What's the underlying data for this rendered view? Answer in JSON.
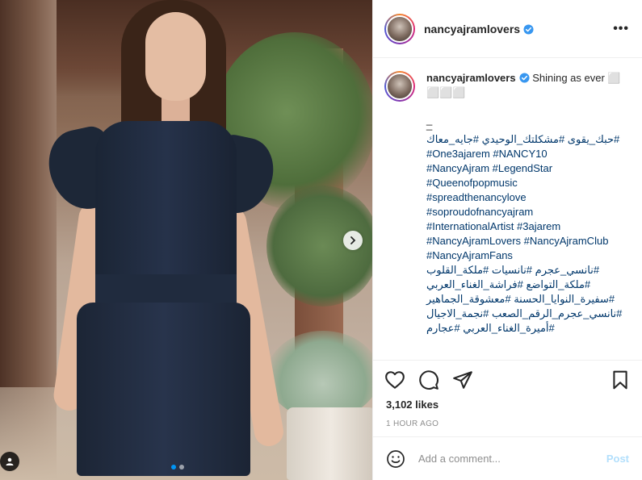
{
  "account": {
    "username": "nancyajramlovers",
    "verified": true
  },
  "header": {
    "more_label": "•••"
  },
  "caption": {
    "username": "nancyajramlovers",
    "text": "Shining as ever ⬜",
    "text_line2": "⬜⬜⬜",
    "separator1": "_",
    "separator2": "_",
    "lines": [
      "#حبك_يقوى #مشكلتك_الوحيدي #جايه_معاك",
      "#One3ajarem #NANCY10",
      "#NancyAjram #LegendStar",
      "#Queenofpopmusic",
      "#spreadthenancylove",
      "#soproudofnancyajram",
      "#InternationalArtist #3ajarem",
      "#NancyAjramLovers #NancyAjramClub",
      "#NancyAjramFans",
      "#نانسي_عجرم #نانسيات #ملكة_القلوب",
      "#ملكة_التواضع #فراشة_الغناء_العربي",
      "#سفيرة_النوايا_الحسنة #معشوقة_الجماهير",
      "#نانسي_عجرم_الرقم_الصعب #نجمة_الاجيال",
      "#أميرة_الغناء_العربي #عجارم"
    ],
    "rtl_lines": [
      0,
      9,
      10,
      11,
      12,
      13
    ]
  },
  "stats": {
    "likes": "3,102 likes",
    "time": "1 HOUR AGO"
  },
  "comment": {
    "placeholder": "Add a comment...",
    "post_label": "Post"
  },
  "icons": {
    "like": "heart-icon",
    "comment": "comment-icon",
    "share": "paper-plane-icon",
    "save": "bookmark-icon",
    "emoji": "emoji-icon",
    "next": "chevron-right-icon",
    "tagged": "user-tag-icon"
  },
  "colors": {
    "link": "#00376b",
    "verified": "#3897f0",
    "post_disabled": "#b2dffc",
    "carousel_active": "#0095f6"
  },
  "carousel": {
    "current": 1,
    "total": 2
  }
}
